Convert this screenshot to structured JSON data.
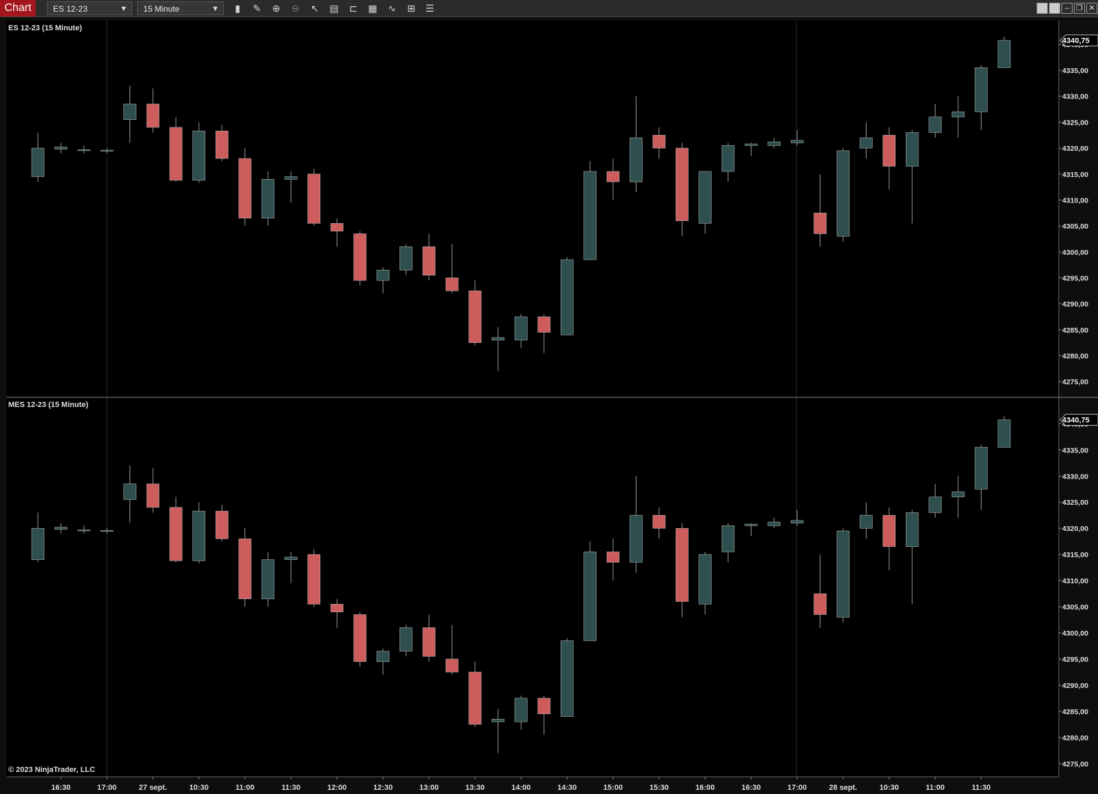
{
  "toolbar": {
    "chart_tab": "Chart",
    "instrument": "ES 12-23",
    "interval": "15 Minute",
    "icons": [
      "bar-type-icon",
      "drawing-pencil-icon",
      "zoom-in-icon",
      "zoom-out-icon",
      "pointer-icon",
      "properties-icon",
      "data-box-icon",
      "chart-style-icon",
      "indicators-icon",
      "strategies-icon",
      "menu-list-icon"
    ],
    "window_buttons": [
      "tile-icon",
      "tile2-icon",
      "minimize-icon",
      "restore-icon",
      "close-icon"
    ]
  },
  "colors": {
    "up": "#2f4f4f",
    "down": "#cd5c5c",
    "background": "#000000",
    "wick": "#999999",
    "text": "#e0e0e0"
  },
  "copyright": "© 2023 NinjaTrader, LLC",
  "panels": [
    {
      "title": "ES 12-23 (15 Minute)",
      "last_price": "4340,75"
    },
    {
      "title": "MES 12-23 (15 Minute)",
      "last_price": "4340,75"
    }
  ],
  "x_labels": [
    "16:30",
    "17:00",
    "27 sept.",
    "10:30",
    "11:00",
    "11:30",
    "12:00",
    "12:30",
    "13:00",
    "13:30",
    "14:00",
    "14:30",
    "15:00",
    "15:30",
    "16:00",
    "16:30",
    "17:00",
    "28 sept.",
    "10:30",
    "11:00",
    "11:30"
  ],
  "chart_data": [
    {
      "type": "candlestick",
      "title": "ES 12-23 (15 Minute)",
      "ylim": [
        4272.5,
        4343.5
      ],
      "y_ticks": [
        "4275,00",
        "4280,00",
        "4285,00",
        "4290,00",
        "4295,00",
        "4300,00",
        "4305,00",
        "4310,00",
        "4315,00",
        "4320,00",
        "4325,00",
        "4330,00",
        "4335,00",
        "4340,00"
      ],
      "last_price": "4340,75",
      "candles": [
        {
          "o": 4314.5,
          "h": 4323.0,
          "l": 4313.5,
          "c": 4320.0
        },
        {
          "o": 4319.8,
          "h": 4321.0,
          "l": 4319.0,
          "c": 4320.2
        },
        {
          "o": 4319.5,
          "h": 4320.5,
          "l": 4319.0,
          "c": 4319.7
        },
        {
          "o": 4319.5,
          "h": 4320.0,
          "l": 4319.0,
          "c": 4319.6
        },
        {
          "o": 4325.5,
          "h": 4332.0,
          "l": 4321.0,
          "c": 4328.5
        },
        {
          "o": 4328.5,
          "h": 4331.5,
          "l": 4323.0,
          "c": 4324.0
        },
        {
          "o": 4324.0,
          "h": 4326.0,
          "l": 4313.5,
          "c": 4313.8
        },
        {
          "o": 4313.8,
          "h": 4325.0,
          "l": 4313.3,
          "c": 4323.3
        },
        {
          "o": 4323.3,
          "h": 4324.5,
          "l": 4317.5,
          "c": 4318.0
        },
        {
          "o": 4318.0,
          "h": 4320.0,
          "l": 4305.0,
          "c": 4306.5
        },
        {
          "o": 4306.5,
          "h": 4315.5,
          "l": 4305.0,
          "c": 4314.0
        },
        {
          "o": 4314.0,
          "h": 4315.5,
          "l": 4309.5,
          "c": 4314.5
        },
        {
          "o": 4315.0,
          "h": 4316.0,
          "l": 4305.0,
          "c": 4305.5
        },
        {
          "o": 4305.5,
          "h": 4306.5,
          "l": 4301.0,
          "c": 4304.0
        },
        {
          "o": 4303.5,
          "h": 4304.0,
          "l": 4293.5,
          "c": 4294.5
        },
        {
          "o": 4294.5,
          "h": 4297.0,
          "l": 4292.0,
          "c": 4296.5
        },
        {
          "o": 4296.5,
          "h": 4301.5,
          "l": 4295.5,
          "c": 4301.0
        },
        {
          "o": 4301.0,
          "h": 4303.5,
          "l": 4294.5,
          "c": 4295.5
        },
        {
          "o": 4295.0,
          "h": 4301.5,
          "l": 4292.0,
          "c": 4292.5
        },
        {
          "o": 4292.5,
          "h": 4294.5,
          "l": 4282.0,
          "c": 4282.5
        },
        {
          "o": 4283.0,
          "h": 4285.5,
          "l": 4277.0,
          "c": 4283.5
        },
        {
          "o": 4283.0,
          "h": 4288.0,
          "l": 4281.5,
          "c": 4287.5
        },
        {
          "o": 4287.5,
          "h": 4288.0,
          "l": 4280.5,
          "c": 4284.5
        },
        {
          "o": 4284.0,
          "h": 4299.0,
          "l": 4284.0,
          "c": 4298.5
        },
        {
          "o": 4298.5,
          "h": 4317.5,
          "l": 4298.5,
          "c": 4315.5
        },
        {
          "o": 4315.5,
          "h": 4318.0,
          "l": 4310.0,
          "c": 4313.5
        },
        {
          "o": 4313.5,
          "h": 4330.0,
          "l": 4311.5,
          "c": 4322.0
        },
        {
          "o": 4322.5,
          "h": 4324.0,
          "l": 4318.0,
          "c": 4320.0
        },
        {
          "o": 4320.0,
          "h": 4321.0,
          "l": 4303.0,
          "c": 4306.0
        },
        {
          "o": 4305.5,
          "h": 4315.5,
          "l": 4303.5,
          "c": 4315.5
        },
        {
          "o": 4315.5,
          "h": 4321.0,
          "l": 4313.5,
          "c": 4320.5
        },
        {
          "o": 4320.5,
          "h": 4321.0,
          "l": 4318.5,
          "c": 4320.8
        },
        {
          "o": 4320.5,
          "h": 4322.0,
          "l": 4320.0,
          "c": 4321.2
        },
        {
          "o": 4321.0,
          "h": 4323.5,
          "l": 4320.5,
          "c": 4321.5
        },
        {
          "o": 4307.5,
          "h": 4315.0,
          "l": 4301.0,
          "c": 4303.5
        },
        {
          "o": 4303.0,
          "h": 4320.0,
          "l": 4302.0,
          "c": 4319.5
        },
        {
          "o": 4320.0,
          "h": 4325.0,
          "l": 4318.0,
          "c": 4322.0
        },
        {
          "o": 4322.5,
          "h": 4324.0,
          "l": 4312.0,
          "c": 4316.5
        },
        {
          "o": 4316.5,
          "h": 4323.5,
          "l": 4305.5,
          "c": 4323.0
        },
        {
          "o": 4323.0,
          "h": 4328.5,
          "l": 4322.0,
          "c": 4326.0
        },
        {
          "o": 4326.0,
          "h": 4330.0,
          "l": 4322.0,
          "c": 4327.0
        },
        {
          "o": 4327.0,
          "h": 4336.0,
          "l": 4323.5,
          "c": 4335.5
        },
        {
          "o": 4335.5,
          "h": 4341.5,
          "l": 4335.5,
          "c": 4340.75
        }
      ]
    },
    {
      "type": "candlestick",
      "title": "MES 12-23 (15 Minute)",
      "ylim": [
        4273.0,
        4344.0
      ],
      "y_ticks": [
        "4275,00",
        "4280,00",
        "4285,00",
        "4290,00",
        "4295,00",
        "4300,00",
        "4305,00",
        "4310,00",
        "4315,00",
        "4320,00",
        "4325,00",
        "4330,00",
        "4335,00",
        "4340,00"
      ],
      "last_price": "4340,75",
      "candles": [
        {
          "o": 4314.0,
          "h": 4323.0,
          "l": 4313.5,
          "c": 4320.0
        },
        {
          "o": 4319.8,
          "h": 4321.0,
          "l": 4319.0,
          "c": 4320.2
        },
        {
          "o": 4319.5,
          "h": 4320.5,
          "l": 4319.0,
          "c": 4319.7
        },
        {
          "o": 4319.5,
          "h": 4320.0,
          "l": 4319.0,
          "c": 4319.6
        },
        {
          "o": 4325.5,
          "h": 4332.0,
          "l": 4321.0,
          "c": 4328.5
        },
        {
          "o": 4328.5,
          "h": 4331.5,
          "l": 4323.0,
          "c": 4324.0
        },
        {
          "o": 4324.0,
          "h": 4326.0,
          "l": 4313.5,
          "c": 4313.8
        },
        {
          "o": 4313.8,
          "h": 4325.0,
          "l": 4313.3,
          "c": 4323.3
        },
        {
          "o": 4323.3,
          "h": 4324.5,
          "l": 4317.5,
          "c": 4318.0
        },
        {
          "o": 4318.0,
          "h": 4320.0,
          "l": 4305.0,
          "c": 4306.5
        },
        {
          "o": 4306.5,
          "h": 4315.5,
          "l": 4305.0,
          "c": 4314.0
        },
        {
          "o": 4314.0,
          "h": 4315.5,
          "l": 4309.5,
          "c": 4314.5
        },
        {
          "o": 4315.0,
          "h": 4316.0,
          "l": 4305.0,
          "c": 4305.5
        },
        {
          "o": 4305.5,
          "h": 4306.5,
          "l": 4301.0,
          "c": 4304.0
        },
        {
          "o": 4303.5,
          "h": 4304.0,
          "l": 4293.5,
          "c": 4294.5
        },
        {
          "o": 4294.5,
          "h": 4297.0,
          "l": 4292.0,
          "c": 4296.5
        },
        {
          "o": 4296.5,
          "h": 4301.5,
          "l": 4295.5,
          "c": 4301.0
        },
        {
          "o": 4301.0,
          "h": 4303.5,
          "l": 4294.5,
          "c": 4295.5
        },
        {
          "o": 4295.0,
          "h": 4301.5,
          "l": 4292.0,
          "c": 4292.5
        },
        {
          "o": 4292.5,
          "h": 4294.5,
          "l": 4282.0,
          "c": 4282.5
        },
        {
          "o": 4283.0,
          "h": 4285.5,
          "l": 4277.0,
          "c": 4283.5
        },
        {
          "o": 4283.0,
          "h": 4288.0,
          "l": 4281.5,
          "c": 4287.5
        },
        {
          "o": 4287.5,
          "h": 4288.0,
          "l": 4280.5,
          "c": 4284.5
        },
        {
          "o": 4284.0,
          "h": 4299.0,
          "l": 4284.0,
          "c": 4298.5
        },
        {
          "o": 4298.5,
          "h": 4317.5,
          "l": 4298.5,
          "c": 4315.5
        },
        {
          "o": 4315.5,
          "h": 4318.0,
          "l": 4310.0,
          "c": 4313.5
        },
        {
          "o": 4313.5,
          "h": 4330.0,
          "l": 4311.5,
          "c": 4322.5
        },
        {
          "o": 4322.5,
          "h": 4324.0,
          "l": 4318.0,
          "c": 4320.0
        },
        {
          "o": 4320.0,
          "h": 4321.0,
          "l": 4303.0,
          "c": 4306.0
        },
        {
          "o": 4305.5,
          "h": 4315.5,
          "l": 4303.5,
          "c": 4315.0
        },
        {
          "o": 4315.5,
          "h": 4321.0,
          "l": 4313.5,
          "c": 4320.5
        },
        {
          "o": 4320.5,
          "h": 4321.0,
          "l": 4318.5,
          "c": 4320.8
        },
        {
          "o": 4320.5,
          "h": 4322.0,
          "l": 4320.0,
          "c": 4321.2
        },
        {
          "o": 4321.0,
          "h": 4323.5,
          "l": 4320.5,
          "c": 4321.5
        },
        {
          "o": 4307.5,
          "h": 4315.0,
          "l": 4301.0,
          "c": 4303.5
        },
        {
          "o": 4303.0,
          "h": 4320.0,
          "l": 4302.0,
          "c": 4319.5
        },
        {
          "o": 4320.0,
          "h": 4325.0,
          "l": 4318.0,
          "c": 4322.5
        },
        {
          "o": 4322.5,
          "h": 4324.0,
          "l": 4312.0,
          "c": 4316.5
        },
        {
          "o": 4316.5,
          "h": 4323.5,
          "l": 4305.5,
          "c": 4323.0
        },
        {
          "o": 4323.0,
          "h": 4328.5,
          "l": 4322.0,
          "c": 4326.0
        },
        {
          "o": 4326.0,
          "h": 4330.0,
          "l": 4322.0,
          "c": 4327.0
        },
        {
          "o": 4327.5,
          "h": 4336.0,
          "l": 4323.5,
          "c": 4335.5
        },
        {
          "o": 4335.5,
          "h": 4341.5,
          "l": 4335.5,
          "c": 4340.75
        }
      ]
    }
  ]
}
